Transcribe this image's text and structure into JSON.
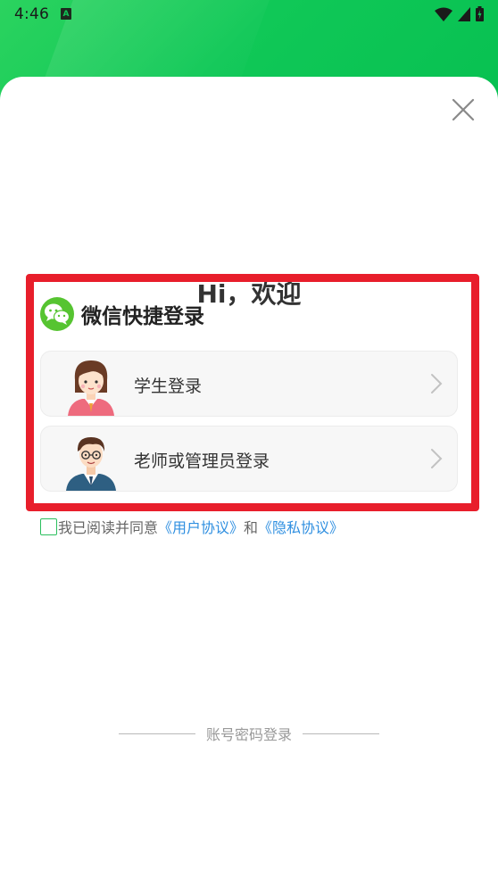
{
  "status_bar": {
    "time": "4:46",
    "notification_icon": "A"
  },
  "welcome": {
    "title": "Hi，欢迎"
  },
  "wechat_login": {
    "title": "微信快捷登录",
    "options": [
      {
        "label": "学生登录"
      },
      {
        "label": "老师或管理员登录"
      }
    ]
  },
  "agreement": {
    "prefix": "我已阅读并同意",
    "user_agreement": "《用户协议》",
    "conjunction": "和",
    "privacy_agreement": "《隐私协议》"
  },
  "alt_login": {
    "label": "账号密码登录"
  },
  "colors": {
    "brand_green": "#10c857",
    "highlight_red": "#e81e2b",
    "link_blue": "#2f8fe0"
  }
}
